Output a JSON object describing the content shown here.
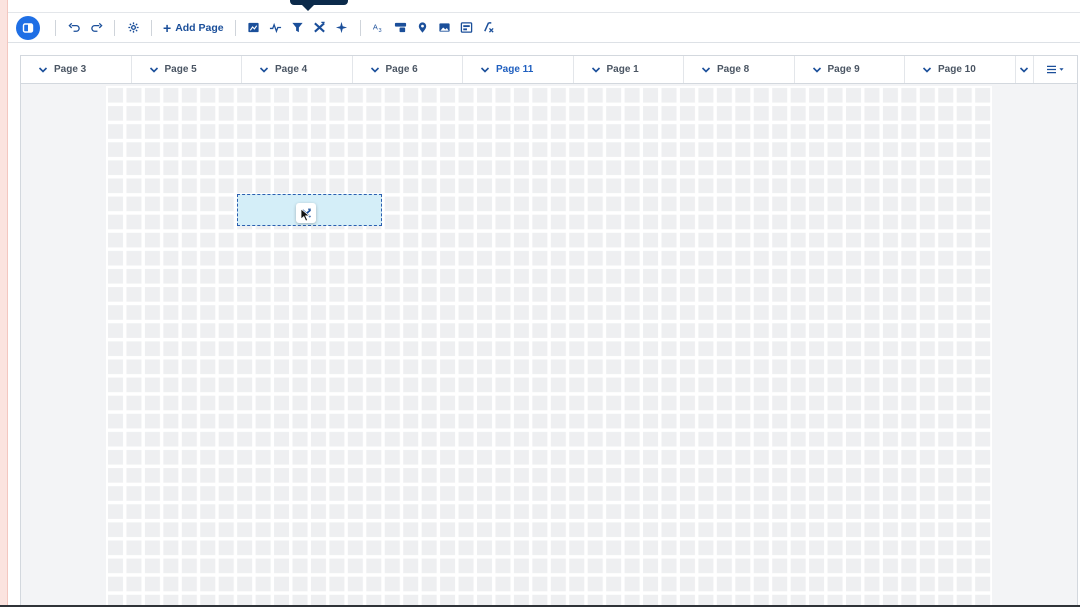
{
  "toolbar": {
    "add_page_label": "Add Page",
    "icons": [
      "panel-icon",
      "undo-icon",
      "redo-icon",
      "settings-icon",
      "add-icon",
      "chart-icon",
      "line-chart-icon",
      "filter-icon",
      "formula-icon",
      "sparkle-icon",
      "text-icon",
      "shapes-icon",
      "map-pin-icon",
      "image-icon",
      "table-icon",
      "function-icon"
    ]
  },
  "tabs": [
    {
      "label": "Page 3"
    },
    {
      "label": "Page 5"
    },
    {
      "label": "Page 4"
    },
    {
      "label": "Page 6"
    },
    {
      "label": "Page 11",
      "active": true
    },
    {
      "label": "Page 1"
    },
    {
      "label": "Page 8"
    },
    {
      "label": "Page 9"
    },
    {
      "label": "Page 10"
    }
  ],
  "colors": {
    "accent": "#1f6fe5",
    "icon": "#1b4f9a",
    "drop_fill": "#d4eef8",
    "drop_border": "#2a5fb0"
  }
}
